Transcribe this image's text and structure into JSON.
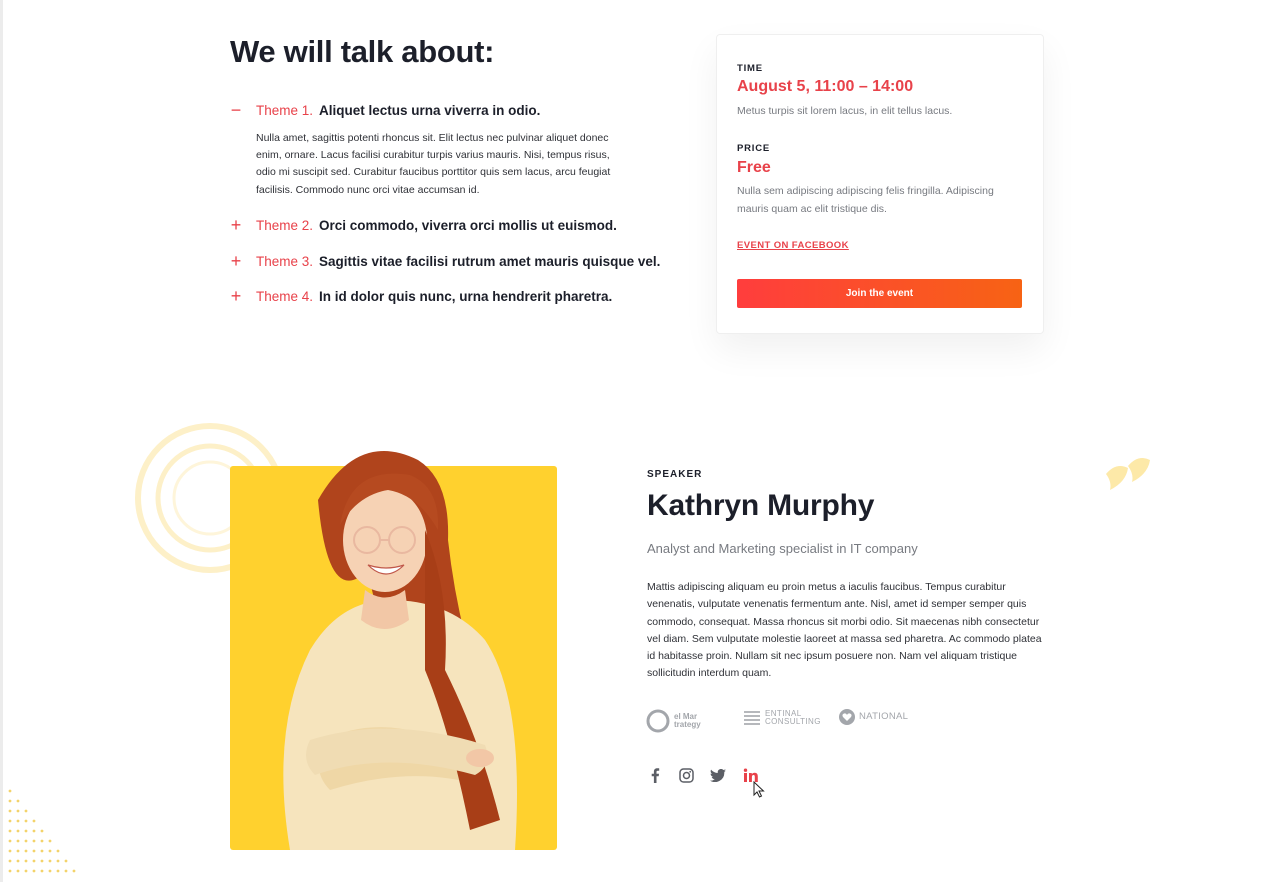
{
  "agenda": {
    "title": "We will talk about:",
    "themes": [
      {
        "toggle": "−",
        "number": "Theme 1.",
        "title": "Aliquet lectus urna viverra in odio.",
        "expanded": true,
        "description": "Nulla amet, sagittis potenti rhoncus sit. Elit lectus nec pulvinar aliquet donec enim, ornare. Lacus facilisi curabitur turpis varius mauris. Nisi, tempus risus, odio mi suscipit sed. Curabitur faucibus porttitor quis sem lacus, arcu feugiat facilisis. Commodo nunc orci vitae accumsan id."
      },
      {
        "toggle": "+",
        "number": "Theme 2.",
        "title": "Orci commodo, viverra orci mollis ut euismod.",
        "expanded": false
      },
      {
        "toggle": "+",
        "number": "Theme 3.",
        "title": "Sagittis vitae facilisi rutrum amet mauris quisque vel.",
        "expanded": false
      },
      {
        "toggle": "+",
        "number": "Theme 4.",
        "title": "In id dolor quis nunc, urna hendrerit pharetra.",
        "expanded": false
      }
    ]
  },
  "event_card": {
    "time_label": "TIME",
    "time_value": "August 5, 11:00 – 14:00",
    "time_note": "Metus turpis sit lorem lacus, in elit tellus lacus.",
    "price_label": "PRICE",
    "price_value": "Free",
    "price_note": "Nulla sem adipiscing adipiscing felis fringilla. Adipiscing mauris quam ac elit tristique dis.",
    "facebook_link": "EVENT ON FACEBOOK",
    "join_button": "Join the event"
  },
  "speaker": {
    "eyebrow": "SPEAKER",
    "name": "Kathryn Murphy",
    "role": "Analyst and Marketing specialist in IT company",
    "bio": "Mattis adipiscing aliquam eu proin metus a iaculis faucibus. Tempus curabitur venenatis, vulputate venenatis fermentum ante. Nisl, amet id semper semper quis commodo, consequat. Massa rhoncus sit morbi odio. Sit maecenas nibh consectetur vel diam. Sem vulputate molestie laoreet at massa sed pharetra. Ac commodo platea id habitasse proin. Nullam sit nec ipsum posuere non. Nam vel aliquam tristique sollicitudin interdum quam.",
    "partners": [
      {
        "line1": "el Mar",
        "line2": "trategy",
        "icon": "swirl-logo-icon"
      },
      {
        "line1": "ENTINAL",
        "line2": "CONSULTING",
        "icon": "stacked-lines-logo-icon"
      },
      {
        "line1": "NATIONAL",
        "icon": "heart-badge-logo-icon"
      }
    ],
    "social": [
      "facebook-icon",
      "instagram-icon",
      "twitter-icon",
      "linkedin-icon"
    ]
  },
  "colors": {
    "accent": "#e8424a",
    "button_gradient_start": "#ff3d3d",
    "button_gradient_end": "#f76314",
    "photo_background": "#ffd12e",
    "muted_text": "#777a80",
    "heading": "#1c1f2a"
  }
}
